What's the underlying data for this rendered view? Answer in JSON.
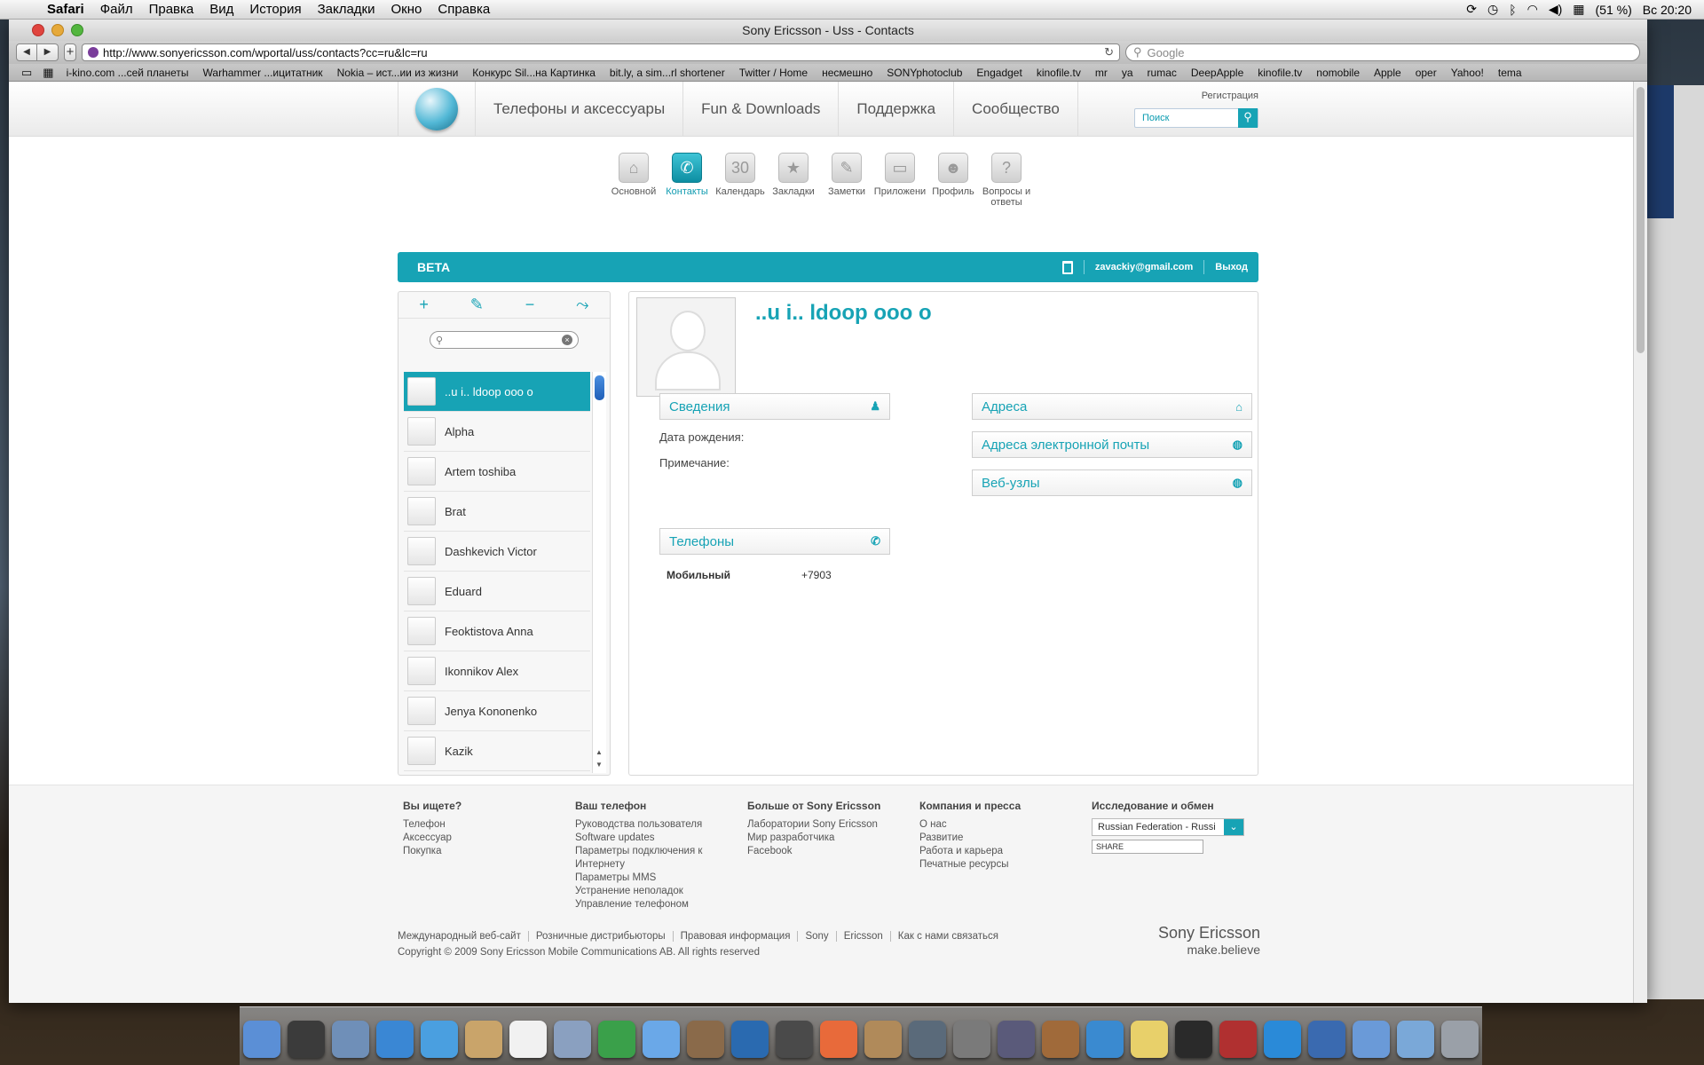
{
  "menubar": {
    "app": "Safari",
    "items": [
      "Файл",
      "Правка",
      "Вид",
      "История",
      "Закладки",
      "Окно",
      "Справка"
    ],
    "battery": "(51 %)",
    "clock": "Вс 20:20"
  },
  "window": {
    "title": "Sony Ericsson - Uss - Contacts",
    "url": "http://www.sonyericsson.com/wportal/uss/contacts?cc=ru&lc=ru",
    "search_placeholder": "Google",
    "bookmarks": [
      "i-kino.com ...сей планеты",
      "Warhammer ...ицитатник",
      "Nokia – ист...ии из жизни",
      "Конкурс Sil...на Картинка",
      "bit.ly, a sim...rl shortener",
      "Twitter / Home",
      "несмешно",
      "SONYphotoclub",
      "Engadget",
      "kinofile.tv",
      "mr",
      "ya",
      "rumac",
      "DeepApple",
      "kinofile.tv",
      "nomobile",
      "Apple",
      "oper",
      "Yahoo!",
      "tema"
    ]
  },
  "site": {
    "nav": [
      "Телефоны и аксессуары",
      "Fun & Downloads",
      "Поддержка",
      "Сообщество"
    ],
    "register": "Регистрация",
    "search_placeholder": "Поиск",
    "apps": [
      {
        "label": "Основной",
        "icon": "home-icon"
      },
      {
        "label": "Контакты",
        "icon": "phone-icon",
        "active": true
      },
      {
        "label": "Календарь",
        "icon": "calendar-icon"
      },
      {
        "label": "Закладки",
        "icon": "star-icon"
      },
      {
        "label": "Заметки",
        "icon": "note-icon"
      },
      {
        "label": "Приложени",
        "icon": "apps-icon"
      },
      {
        "label": "Профиль",
        "icon": "profile-icon"
      },
      {
        "label": "Вопросы и ответы",
        "icon": "question-icon"
      }
    ],
    "beta_label": "BETA",
    "user_email": "zavackiy@gmail.com",
    "logout": "Выход"
  },
  "contacts": {
    "tools": [
      "+",
      "✎",
      "−",
      "⤳"
    ],
    "list": [
      "..u i.. ldoop ooo o",
      "Alpha",
      "Artem toshiba",
      "Brat",
      "Dashkevich Victor",
      "Eduard",
      "Feoktistova Anna",
      "Ikonnikov Alex",
      "Jenya Kononenko",
      "Kazik"
    ],
    "selected_index": 0
  },
  "detail": {
    "name": "..u i.. ldoop ooo o",
    "sections": {
      "info": "Сведения",
      "addresses": "Адреса",
      "emails": "Адреса электронной почты",
      "websites": "Веб-узлы",
      "phones": "Телефоны"
    },
    "birthday_label": "Дата рождения:",
    "note_label": "Примечание:",
    "phone_type": "Мобильный",
    "phone_number": "+7903"
  },
  "footer": {
    "columns": [
      {
        "title": "Вы ищете?",
        "links": [
          "Телефон",
          "Аксессуар",
          "Покупка"
        ]
      },
      {
        "title": "Ваш телефон",
        "links": [
          "Руководства пользователя",
          "Software updates",
          "Параметры подключения к Интернету",
          "Параметры MMS",
          "Устранение неполадок",
          "Управление телефоном"
        ]
      },
      {
        "title": "Больше от Sony Ericsson",
        "links": [
          "Лаборатории Sony Ericsson",
          "Мир разработчика",
          "Facebook"
        ]
      },
      {
        "title": "Компания и пресса",
        "links": [
          "О нас",
          "Развитие",
          "Работа и карьера",
          "Печатные ресурсы"
        ]
      },
      {
        "title": "Исследование и обмен",
        "links": []
      }
    ],
    "region": "Russian Federation - Russi",
    "share": "SHARE",
    "bottom_links": [
      "Международный веб-сайт",
      "Розничные дистрибьюторы",
      "Правовая информация",
      "Sony",
      "Ericsson",
      "Как с нами связаться"
    ],
    "copyright": "Copyright © 2009 Sony Ericsson Mobile Communications AB. All rights reserved",
    "brand": "Sony Ericsson",
    "tagline": "make.believe"
  }
}
